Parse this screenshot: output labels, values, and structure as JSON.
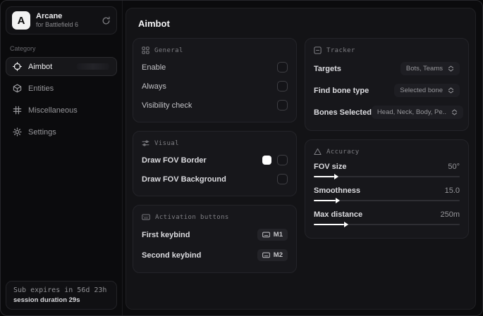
{
  "brand": {
    "name": "Arcane",
    "subtitle": "for Battlefield 6",
    "logo_letter": "A"
  },
  "sidebar": {
    "category_label": "Category",
    "items": [
      {
        "label": "Aimbot",
        "selected": true
      },
      {
        "label": "Entities",
        "selected": false
      },
      {
        "label": "Miscellaneous",
        "selected": false
      },
      {
        "label": "Settings",
        "selected": false
      }
    ],
    "footer": {
      "sub_expires": "Sub expires in 56d 23h",
      "session_duration": "session duration 29s"
    }
  },
  "main": {
    "title": "Aimbot",
    "general": {
      "title": "General",
      "rows": [
        {
          "label": "Enable",
          "checked": false
        },
        {
          "label": "Always",
          "checked": false
        },
        {
          "label": "Visibility check",
          "checked": false
        }
      ]
    },
    "visual": {
      "title": "Visual",
      "rows": [
        {
          "label": "Draw FOV Border",
          "swatch_color": "#ffffff",
          "checked": false
        },
        {
          "label": "Draw FOV Background",
          "checked": false
        }
      ]
    },
    "activation": {
      "title": "Activation buttons",
      "rows": [
        {
          "label": "First keybind",
          "key": "M1"
        },
        {
          "label": "Second keybind",
          "key": "M2"
        }
      ]
    },
    "tracker": {
      "title": "Tracker",
      "rows": [
        {
          "label": "Targets",
          "value": "Bots, Teams"
        },
        {
          "label": "Find bone type",
          "value": "Selected bone"
        },
        {
          "label": "Bones Selected",
          "value": "Head, Neck, Body, Pe.."
        }
      ]
    },
    "accuracy": {
      "title": "Accuracy",
      "rows": [
        {
          "label": "FOV size",
          "value": "50°",
          "percent": 14
        },
        {
          "label": "Smoothness",
          "value": "15.0",
          "percent": 15
        },
        {
          "label": "Max distance",
          "value": "250m",
          "percent": 21
        }
      ]
    }
  },
  "colors": {
    "accent": "#ffffff",
    "card_bg": "#17171b",
    "panel_bg": "#131316"
  }
}
